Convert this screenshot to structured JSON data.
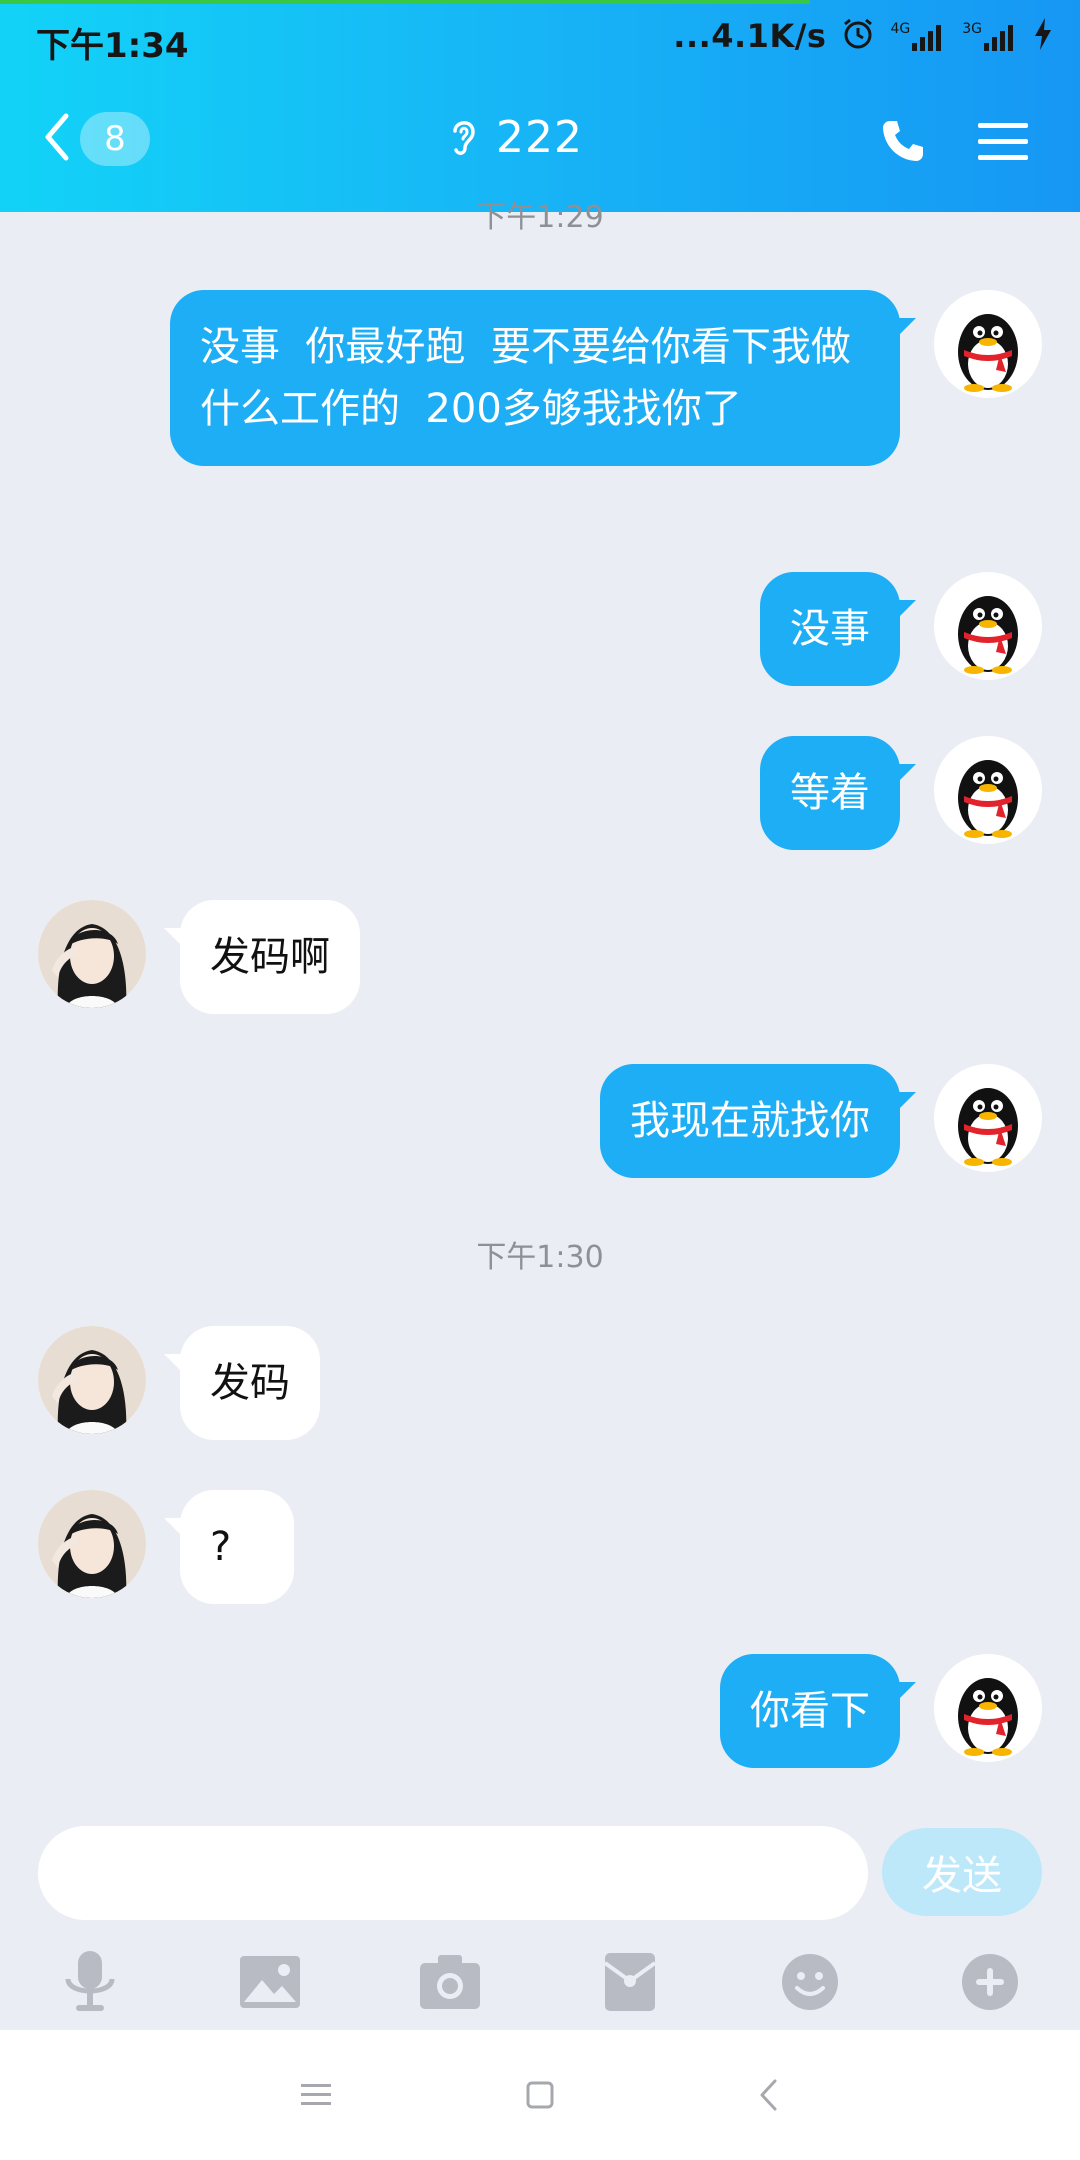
{
  "status_bar": {
    "time": "下午1:34",
    "net_speed": "...4.1K/s",
    "signal1_label": "4G",
    "signal2_label": "3G"
  },
  "header": {
    "unread_count": "8",
    "chat_title": "222"
  },
  "timestamps": {
    "top_partial": "下午1:29",
    "mid": "下午1:30"
  },
  "messages": [
    {
      "side": "me",
      "text": "没事  你最好跑  要不要给你看下我做什么工作的  200多够我找你了"
    },
    {
      "side": "me",
      "text": "没事"
    },
    {
      "side": "me",
      "text": "等着"
    },
    {
      "side": "them",
      "text": "发码啊"
    },
    {
      "side": "me",
      "text": "我现在就找你"
    },
    {
      "side": "them",
      "text": "发码"
    },
    {
      "side": "them",
      "text": "?"
    },
    {
      "side": "me",
      "text": "你看下"
    }
  ],
  "composer": {
    "input_value": "",
    "send_label": "发送"
  },
  "toolbar_icons": [
    "microphone-icon",
    "image-icon",
    "camera-icon",
    "red-packet-icon",
    "emoji-icon",
    "plus-icon"
  ],
  "colors": {
    "header_start": "#12D3F7",
    "header_end": "#1697F4",
    "my_bubble": "#1EAEF6",
    "their_bubble": "#FFFFFF",
    "chat_bg": "#EAEDF4",
    "send_disabled": "#BDE8FA"
  }
}
